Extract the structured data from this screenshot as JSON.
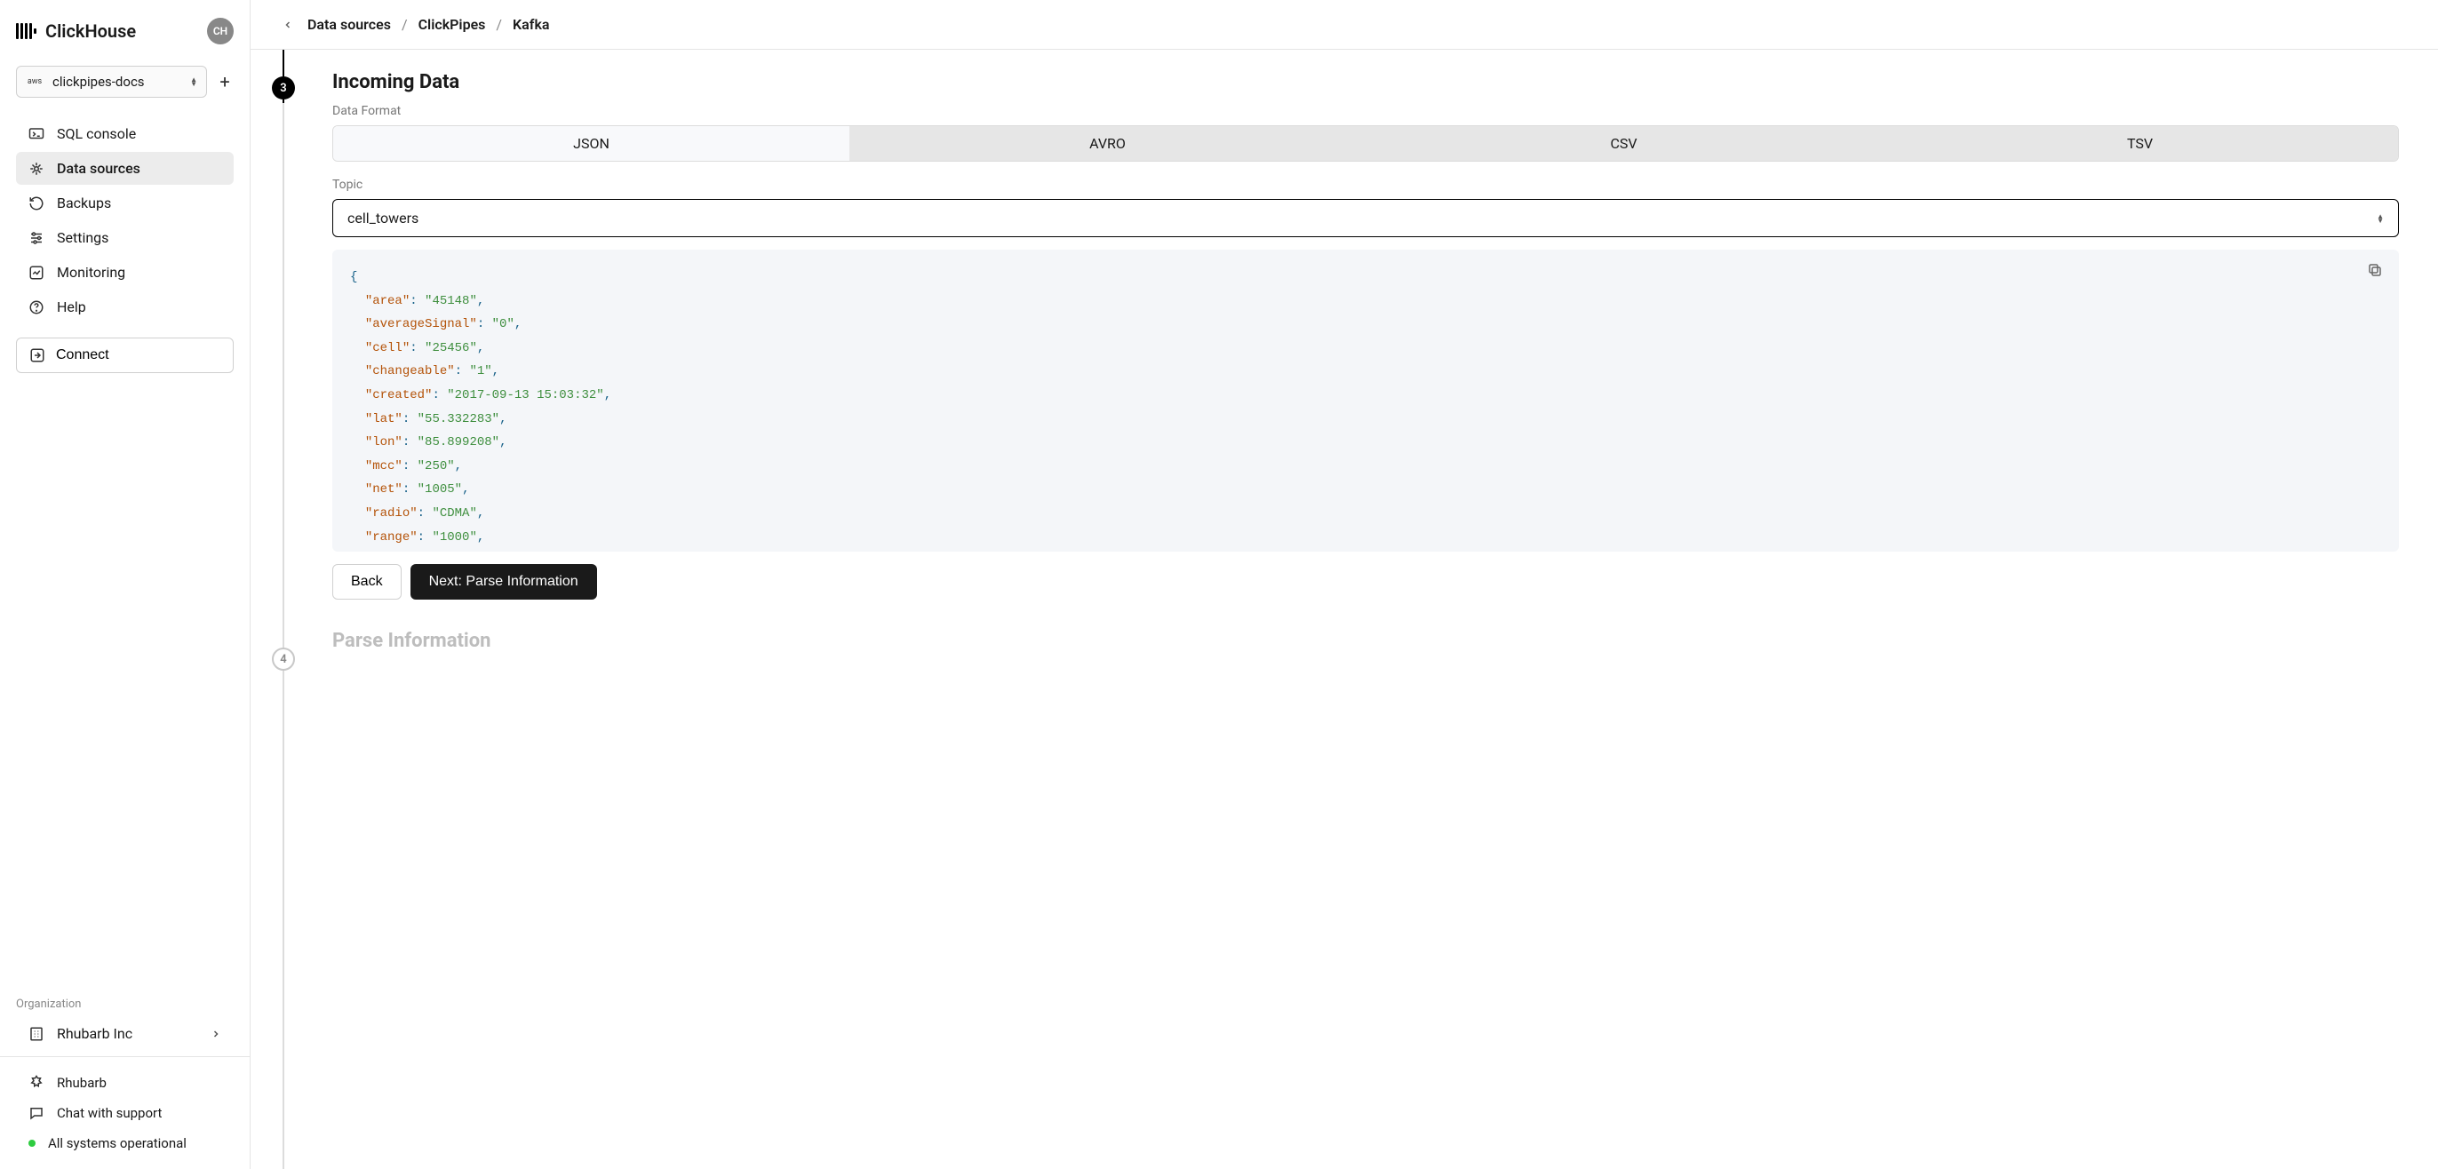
{
  "brand": {
    "name": "ClickHouse",
    "user_initials": "CH"
  },
  "env": {
    "name": "clickpipes-docs"
  },
  "nav": {
    "items": [
      {
        "label": "SQL console"
      },
      {
        "label": "Data sources"
      },
      {
        "label": "Backups"
      },
      {
        "label": "Settings"
      },
      {
        "label": "Monitoring"
      },
      {
        "label": "Help"
      }
    ],
    "connect_label": "Connect"
  },
  "org": {
    "section_label": "Organization",
    "name": "Rhubarb Inc"
  },
  "footer": {
    "user_label": "Rhubarb",
    "chat_label": "Chat with support",
    "status_label": "All systems operational"
  },
  "breadcrumb": {
    "a": "Data sources",
    "b": "ClickPipes",
    "c": "Kafka"
  },
  "step3": {
    "number": "3",
    "title": "Incoming Data",
    "format_label": "Data Format",
    "formats": {
      "a": "JSON",
      "b": "AVRO",
      "c": "CSV",
      "d": "TSV"
    },
    "topic_label": "Topic",
    "topic_value": "cell_towers",
    "sample": [
      {
        "k": "area",
        "v": "45148"
      },
      {
        "k": "averageSignal",
        "v": "0"
      },
      {
        "k": "cell",
        "v": "25456"
      },
      {
        "k": "changeable",
        "v": "1"
      },
      {
        "k": "created",
        "v": "2017-09-13 15:03:32"
      },
      {
        "k": "lat",
        "v": "55.332283"
      },
      {
        "k": "lon",
        "v": "85.899208"
      },
      {
        "k": "mcc",
        "v": "250"
      },
      {
        "k": "net",
        "v": "1005"
      },
      {
        "k": "radio",
        "v": "CDMA"
      },
      {
        "k": "range",
        "v": "1000"
      }
    ],
    "back_label": "Back",
    "next_label": "Next: Parse Information"
  },
  "step4": {
    "number": "4",
    "title": "Parse Information"
  }
}
